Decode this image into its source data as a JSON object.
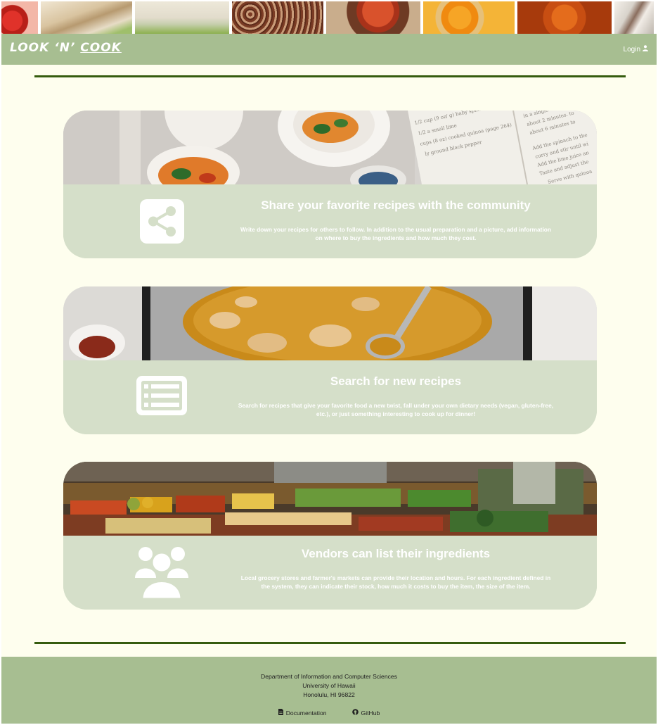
{
  "brand": {
    "logo_left": "LOOK ‘N’ ",
    "logo_right": "COOK"
  },
  "nav": {
    "login_label": "Login"
  },
  "cards": [
    {
      "title": "Share your favorite recipes with the community",
      "description": "Write down your recipes for others to follow. In addition to the usual preparation and a picture, add information on where to buy the ingredients and how much they cost.",
      "icon": "share-icon",
      "banner_text": [
        "1/2 cup (9 oz/ g) baby spinach",
        "1/2 a small lime",
        "cups (8 oz) cooked quinoa (page 264)",
        "ly ground black pepper",
        "Add the spinach to the",
        "curry and stir until wi",
        "Add the lime juice an",
        "Taste and adjust the",
        "Serve with quinoa",
        "in a single",
        "about 2 minutes. to",
        "about 6 minutes to"
      ]
    },
    {
      "title": "Search for new recipes",
      "description": "Search for recipes that give your favorite food a new twist, fall under your own dietary needs (vegan, gluten-free, etc.), or just something interesting to cook up for dinner!",
      "icon": "list-icon"
    },
    {
      "title": "Vendors can list their ingredients",
      "description": "Local grocery stores and farmer's markets can provide their location and hours. For each ingredient defined in the system, they can indicate their stock, how much it costs to buy the item, the size of the item.",
      "icon": "users-icon"
    }
  ],
  "footer": {
    "line1": "Department of Information and Computer Sciences",
    "line2": "University of Hawaii",
    "line3": "Honolulu, HI 96822",
    "documentation_label": "Documentation",
    "github_label": "GitHub"
  },
  "colors": {
    "page_bg": "#fefeee",
    "nav_bg": "#a7be91",
    "card_bg": "#d5dfc9",
    "rule": "#355c0e"
  }
}
